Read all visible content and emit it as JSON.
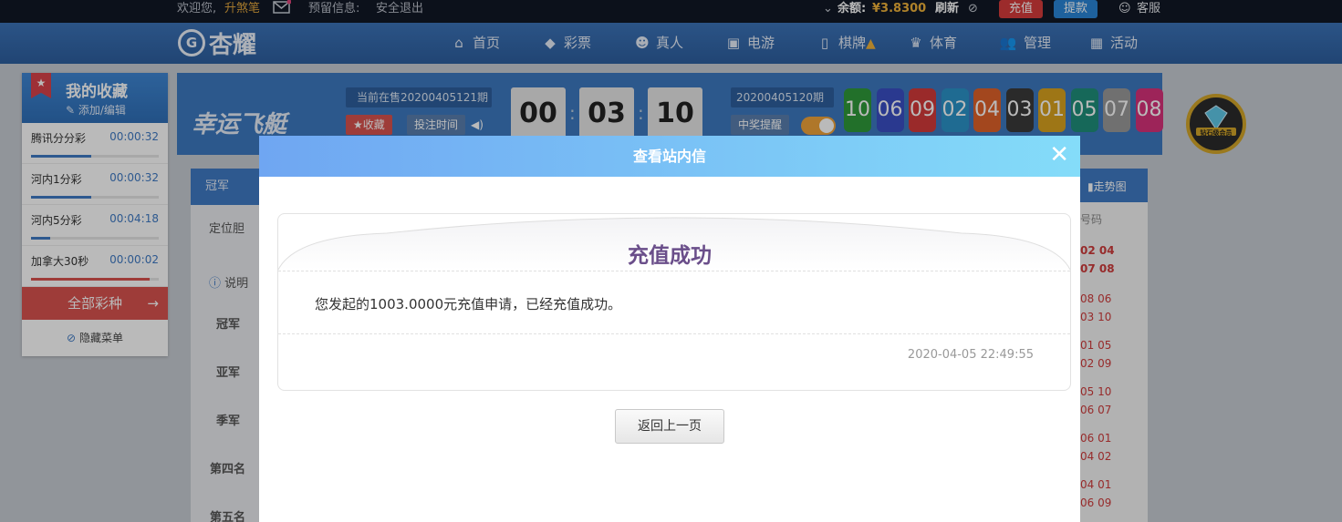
{
  "topbar": {
    "welcome": "欢迎您,",
    "username": "升煞笔",
    "reserved_info": "预留信息:",
    "logout": "安全退出",
    "balance_label": "余额:",
    "balance_value": "¥3.8300",
    "refresh": "刷新",
    "recharge": "充值",
    "withdraw": "提款",
    "service": "客服"
  },
  "logo": {
    "text": "杏耀"
  },
  "nav": {
    "items": [
      {
        "label": "首页",
        "icon": "home-icon"
      },
      {
        "label": "彩票",
        "icon": "ticket-icon"
      },
      {
        "label": "真人",
        "icon": "user-icon"
      },
      {
        "label": "电游",
        "icon": "slot-machine-icon"
      },
      {
        "label": "棋牌",
        "icon": "card-icon"
      },
      {
        "label": "体育",
        "icon": "trophy-icon"
      },
      {
        "label": "管理",
        "icon": "users-icon"
      },
      {
        "label": "活动",
        "icon": "gift-icon"
      }
    ]
  },
  "favorites": {
    "title": "我的收藏",
    "edit": "添加/编辑",
    "items": [
      {
        "name": "腾讯分分彩",
        "time": "00:00:32",
        "progress": 0.47
      },
      {
        "name": "河内1分彩",
        "time": "00:00:32",
        "progress": 0.47
      },
      {
        "name": "河内5分彩",
        "time": "00:04:18",
        "progress": 0.15
      },
      {
        "name": "加拿大30秒",
        "time": "00:00:02",
        "progress": 0.93
      }
    ],
    "all_games": "全部彩种",
    "hide_menu": "隐藏菜单"
  },
  "lottery": {
    "name": "幸运飞艇",
    "current_issue": "当前在售20200405121期",
    "favorite_btn": "收藏",
    "bet_time_btn": "投注时间",
    "countdown": [
      "00",
      "03",
      "10"
    ],
    "prev_issue": "20200405120期",
    "win_reminder": "中奖提醒",
    "balls": [
      {
        "n": "10",
        "c": "#2f9a3a"
      },
      {
        "n": "06",
        "c": "#3a4fc4"
      },
      {
        "n": "09",
        "c": "#d43a3a"
      },
      {
        "n": "02",
        "c": "#2b93c9"
      },
      {
        "n": "04",
        "c": "#e0622a"
      },
      {
        "n": "03",
        "c": "#3a3a3a"
      },
      {
        "n": "01",
        "c": "#d9a21f"
      },
      {
        "n": "05",
        "c": "#1f8f7a"
      },
      {
        "n": "07",
        "c": "#9a9a9a"
      },
      {
        "n": "08",
        "c": "#d8327a"
      }
    ]
  },
  "bet": {
    "tab": "冠军",
    "position": "定位胆",
    "explain": "说明",
    "rows": [
      "冠军",
      "亚军",
      "季军",
      "第四名",
      "第五名"
    ],
    "trend": "走势图",
    "history_header": "号码",
    "history": [
      [
        "02 04",
        "07 08"
      ],
      [
        "08 06",
        "03 10"
      ],
      [
        "01 05",
        "02 09"
      ],
      [
        "05 10",
        "06 07"
      ],
      [
        "06 01",
        "04 02"
      ],
      [
        "04 01",
        "06 09"
      ]
    ]
  },
  "badge": {
    "label": "钻石级会员"
  },
  "modal": {
    "title": "查看站内信",
    "heading": "充值成功",
    "message": "您发起的1003.0000元充值申请，已经充值成功。",
    "time": "2020-04-05 22:49:55",
    "back": "返回上一页"
  }
}
